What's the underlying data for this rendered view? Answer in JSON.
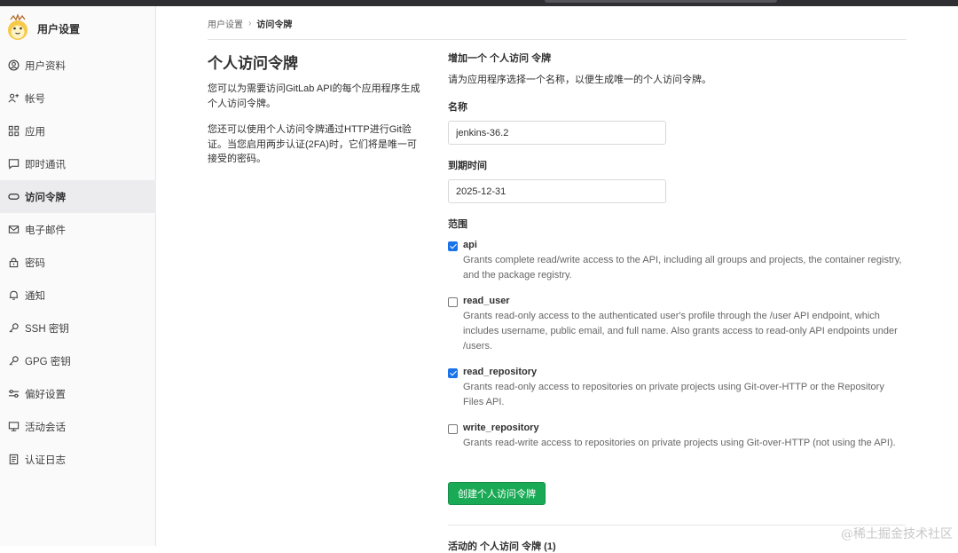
{
  "sidebar": {
    "title": "用户设置",
    "items": [
      {
        "label": "用户资料",
        "icon": "profile-icon"
      },
      {
        "label": "帐号",
        "icon": "account-icon"
      },
      {
        "label": "应用",
        "icon": "applications-icon"
      },
      {
        "label": "即时通讯",
        "icon": "chat-icon"
      },
      {
        "label": "访问令牌",
        "icon": "token-icon",
        "active": true
      },
      {
        "label": "电子邮件",
        "icon": "email-icon"
      },
      {
        "label": "密码",
        "icon": "lock-icon"
      },
      {
        "label": "通知",
        "icon": "bell-icon"
      },
      {
        "label": "SSH 密钥",
        "icon": "key-icon"
      },
      {
        "label": "GPG 密钥",
        "icon": "key-icon"
      },
      {
        "label": "偏好设置",
        "icon": "preferences-icon"
      },
      {
        "label": "活动会话",
        "icon": "monitor-icon"
      },
      {
        "label": "认证日志",
        "icon": "log-icon"
      }
    ]
  },
  "breadcrumb": {
    "parent": "用户设置",
    "separator": "›",
    "current": "访问令牌"
  },
  "intro": {
    "heading": "个人访问令牌",
    "p1": "您可以为需要访问GitLab API的每个应用程序生成个人访问令牌。",
    "p2": "您还可以使用个人访问令牌通过HTTP进行Git验证。当您启用两步认证(2FA)时，它们将是唯一可接受的密码。"
  },
  "form": {
    "title": "增加一个 个人访问 令牌",
    "description": "请为应用程序选择一个名称，以便生成唯一的个人访问令牌。",
    "name_label": "名称",
    "name_value": "jenkins-36.2",
    "expires_label": "到期时间",
    "expires_value": "2025-12-31",
    "scopes_label": "范围",
    "scopes": [
      {
        "name": "api",
        "checked": true,
        "description": "Grants complete read/write access to the API, including all groups and projects, the container registry, and the package registry."
      },
      {
        "name": "read_user",
        "checked": false,
        "description": "Grants read-only access to the authenticated user's profile through the /user API endpoint, which includes username, public email, and full name. Also grants access to read-only API endpoints under /users."
      },
      {
        "name": "read_repository",
        "checked": true,
        "description": "Grants read-only access to repositories on private projects using Git-over-HTTP or the Repository Files API."
      },
      {
        "name": "write_repository",
        "checked": false,
        "description": "Grants read-write access to repositories on private projects using Git-over-HTTP (not using the API)."
      }
    ],
    "submit_label": "创建个人访问令牌"
  },
  "active_tokens_title": "活动的 个人访问 令牌 (1)",
  "watermark": "@稀土掘金技术社区",
  "colors": {
    "accent_green": "#1aaa55",
    "checkbox_blue": "#1a73e8",
    "sidebar_bg": "#fafafa"
  }
}
